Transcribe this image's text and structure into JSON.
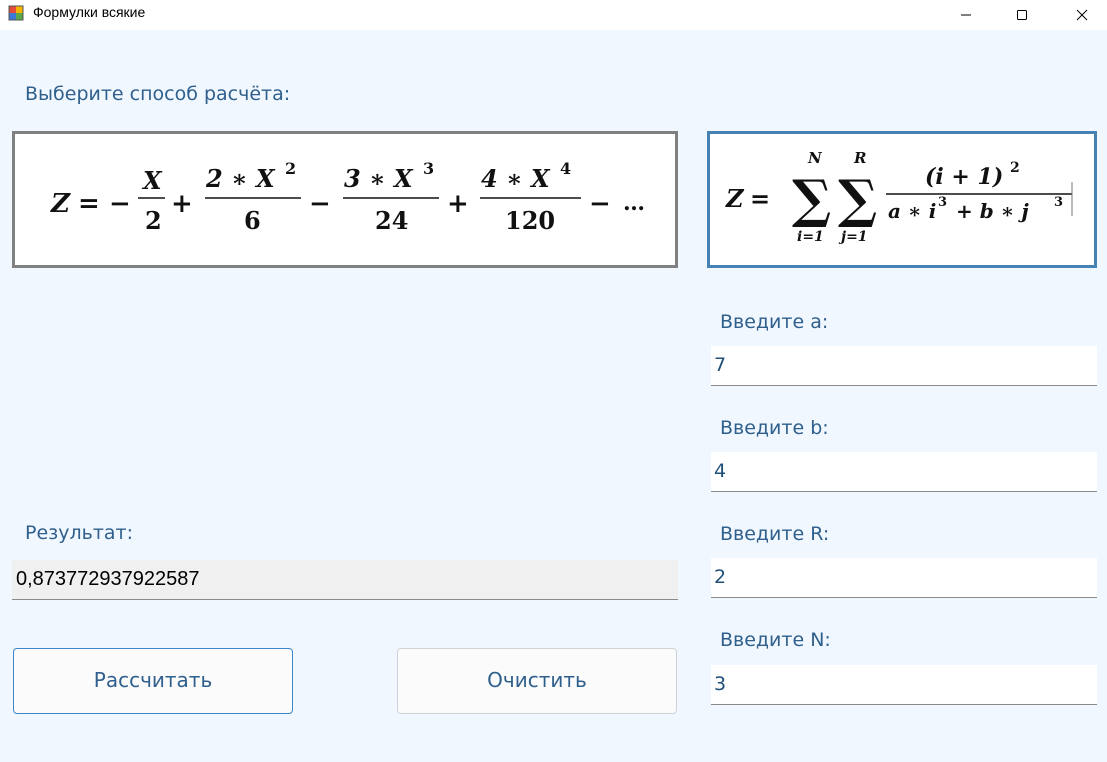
{
  "window": {
    "title": "Формулки всякие"
  },
  "labels": {
    "choose_method": "Выберите способ расчёта:",
    "result": "Результат:",
    "enter_a": "Введите a:",
    "enter_b": "Введите b:",
    "enter_r": "Введите R:",
    "enter_n": "Введите N:"
  },
  "formula1": {
    "lhs": "Z",
    "t1_num": "X",
    "t1_den": "2",
    "t2_num": "2 ∗ X",
    "t2_pow": "2",
    "t2_den": "6",
    "t3_num": "3 ∗ X",
    "t3_pow": "3",
    "t3_den": "24",
    "t4_num": "4 ∗ X",
    "t4_pow": "4",
    "t4_den": "120",
    "ellipsis": "…"
  },
  "formula2": {
    "lhs": "Z",
    "sum1_upper": "N",
    "sum1_lower": "i=1",
    "sum2_upper": "R",
    "sum2_lower": "j=1",
    "numerator": "(i + 1)",
    "num_pow": "2",
    "den_a": "a ∗ i",
    "den_pow1": "3",
    "den_b": "+ b ∗ j",
    "den_pow2": "3"
  },
  "inputs": {
    "a": "7",
    "b": "4",
    "r": "2",
    "n": "3"
  },
  "result": {
    "value": "0,873772937922587"
  },
  "buttons": {
    "calculate": "Рассчитать",
    "clear": "Очистить"
  },
  "colors": {
    "background": "#f0f7fe",
    "label": "#2f5f8c",
    "selected_border": "#4682b4",
    "unselected_border": "#808080"
  }
}
